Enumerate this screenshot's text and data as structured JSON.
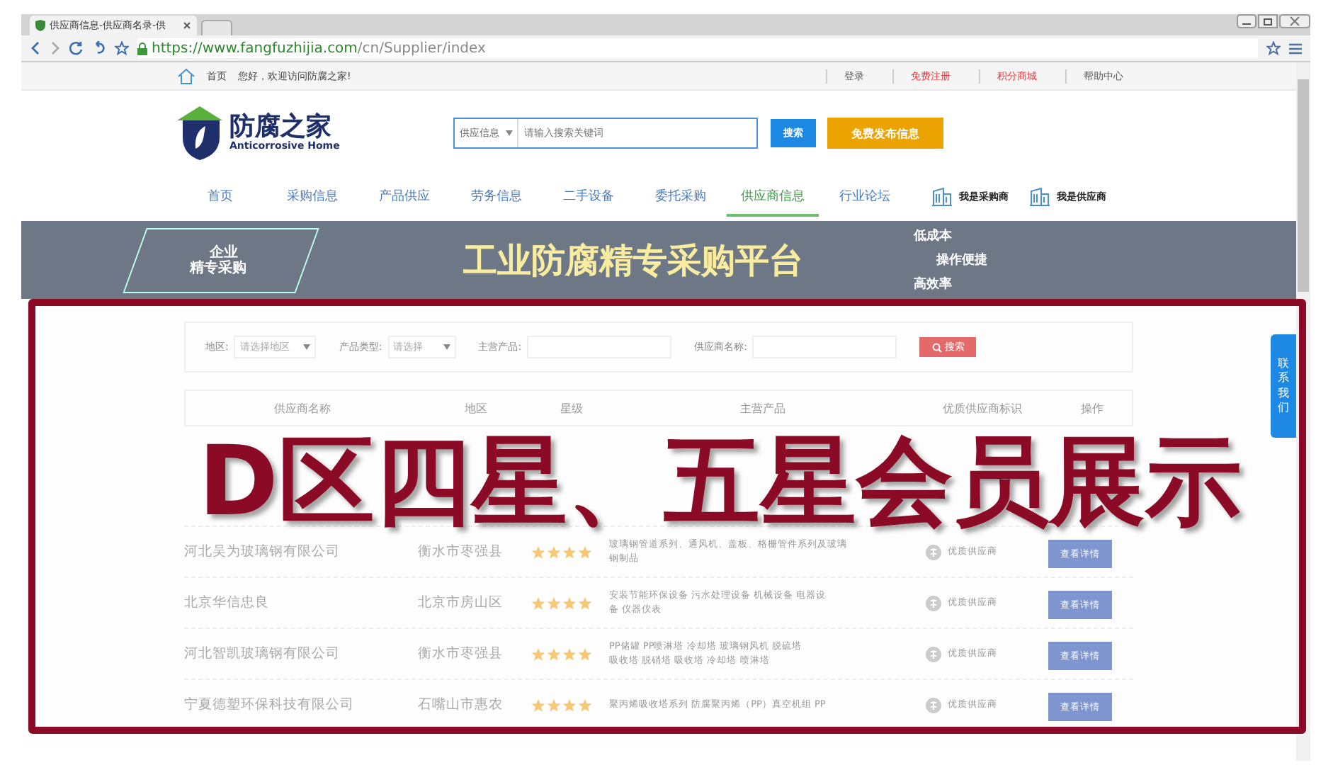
{
  "browser": {
    "tab_title": "供应商信息-供应商名录-供",
    "url_host": "https://www.fangfuzhijia.com",
    "url_path": "/cn/Supplier/index"
  },
  "top_bar": {
    "left": [
      {
        "label": "首页"
      },
      {
        "label": "您好，欢迎访问防腐之家!"
      }
    ],
    "links": [
      {
        "label": "登录",
        "color": "#555555"
      },
      {
        "label": "免费注册",
        "color": "#e8383d"
      },
      {
        "label": "积分商城",
        "color": "#e8383d"
      },
      {
        "label": "帮助中心",
        "color": "#555555"
      }
    ]
  },
  "header": {
    "logo_name": "防腐之家",
    "logo_subtitle": "Anticorrosive Home",
    "search_scope": "供应信息",
    "search_placeholder": "请输入搜索关键词",
    "search_button": "搜索",
    "publish_button": "免费发布信息"
  },
  "nav": [
    {
      "label": "首页",
      "selected": false
    },
    {
      "label": "采购信息",
      "selected": false
    },
    {
      "label": "产品供应",
      "selected": false
    },
    {
      "label": "劳务信息",
      "selected": false
    },
    {
      "label": "二手设备",
      "selected": false
    },
    {
      "label": "委托采购",
      "selected": false
    },
    {
      "label": "供应商信息",
      "selected": true
    },
    {
      "label": "行业论坛",
      "selected": false
    }
  ],
  "roles": [
    "我是采购商",
    "我是供应商"
  ],
  "banner": {
    "badge_lines": [
      "企业",
      "精专采购"
    ],
    "title": "工业防腐精专采购平台",
    "features": [
      "低成本",
      "操作便捷",
      "高效率"
    ]
  },
  "filter": {
    "region_label": "地区:",
    "region_value": "请选择地区",
    "type_label": "产品类型:",
    "type_value": "请选择",
    "product_label": "主营产品:",
    "supplier_label": "供应商名称:",
    "search_button": "搜索"
  },
  "table": {
    "columns": [
      "供应商名称",
      "地区",
      "星级",
      "主营产品",
      "优质供应商标识",
      "操作"
    ],
    "rows": [
      {
        "name": "河北吴为玻璃钢有限公司",
        "region": "衡水市枣强县",
        "stars": 4,
        "products": [
          "玻璃钢管道系列、通风机、盖板、格栅管件系列及玻璃",
          "钢制品"
        ],
        "badge": "优质供应商",
        "action": "查看详情"
      },
      {
        "name": "北京华信忠良",
        "region": "北京市房山区",
        "stars": 4,
        "products": [
          "安装节能环保设备 污水处理设备 机械设备 电器设",
          "备 仪器仪表"
        ],
        "badge": "优质供应商",
        "action": "查看详情"
      },
      {
        "name": "河北智凯玻璃钢有限公司",
        "region": "衡水市枣强县",
        "stars": 4,
        "products": [
          "PP储罐 PP喷淋塔 冷却塔 玻璃钢风机 脱硫塔",
          "吸收塔 脱硝塔 吸收塔 冷却塔 喷淋塔"
        ],
        "badge": "优质供应商",
        "action": "查看详情"
      },
      {
        "name": "宁夏德塑环保科技有限公司",
        "region": "石嘴山市惠农",
        "stars": 4,
        "products": [
          "聚丙烯吸收塔系列 防腐聚丙烯（PP）真空机组 PP"
        ],
        "badge": "优质供应商",
        "action": "查看详情"
      }
    ]
  },
  "contact_tab": "联系我们",
  "overlay_caption": "D区四星、五星会员展示"
}
